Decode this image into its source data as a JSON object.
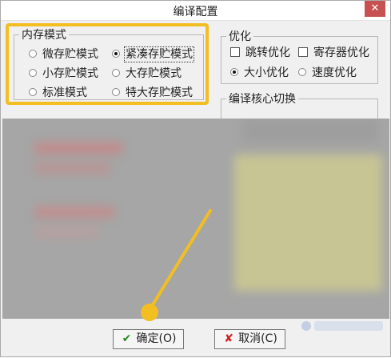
{
  "window": {
    "title": "编译配置",
    "close": "✕"
  },
  "memory_mode": {
    "title": "内存模式",
    "options": [
      {
        "label": "微存贮模式",
        "selected": false
      },
      {
        "label": "紧凑存贮模式",
        "selected": true
      },
      {
        "label": "小存贮模式",
        "selected": false
      },
      {
        "label": "大存贮模式",
        "selected": false
      },
      {
        "label": "标准模式",
        "selected": false
      },
      {
        "label": "特大存贮模式",
        "selected": false
      }
    ]
  },
  "optimization": {
    "title": "优化",
    "checks": [
      {
        "label": "跳转优化",
        "checked": false
      },
      {
        "label": "寄存器优化",
        "checked": false
      }
    ],
    "radios": [
      {
        "label": "大小优化",
        "selected": true
      },
      {
        "label": "速度优化",
        "selected": false
      }
    ]
  },
  "compiler_core": {
    "title": "编译核心切换"
  },
  "buttons": {
    "ok_label": "确定",
    "ok_shortcut": "(O)",
    "cancel_label": "取消",
    "cancel_shortcut": "(C)"
  },
  "colors": {
    "highlight": "#f2be22",
    "ok_icon": "#2a8a2a",
    "cancel_icon": "#cc2222"
  },
  "icons": {
    "ok": "check-icon",
    "cancel": "x-icon"
  }
}
